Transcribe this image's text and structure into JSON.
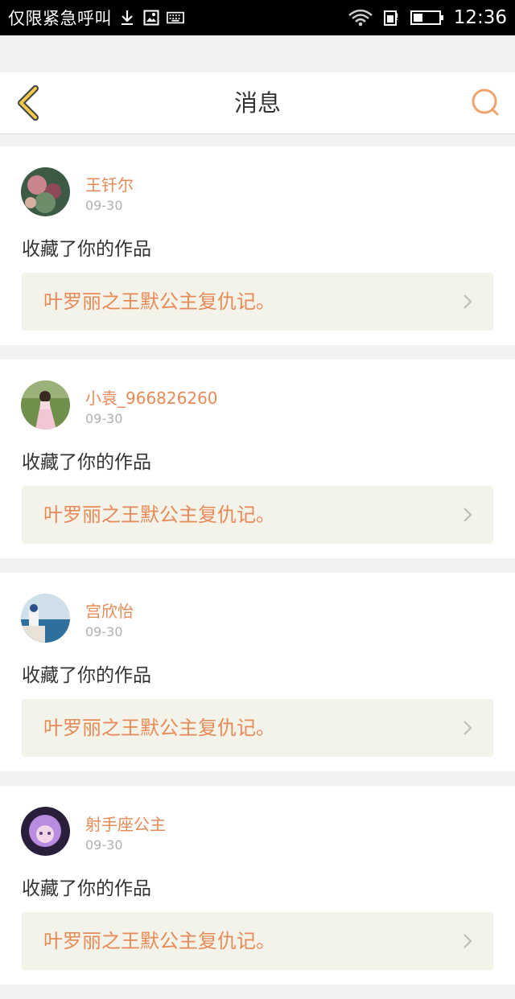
{
  "status_bar": {
    "carrier": "仅限紧急呼叫",
    "time": "12:36",
    "icons": [
      "download-icon",
      "image-icon",
      "keyboard-icon",
      "wifi-icon",
      "data-icon",
      "battery-icon"
    ]
  },
  "header": {
    "title": "消息",
    "back_icon": "chevron-left-icon",
    "search_icon": "search-icon",
    "accent_color": "#f2b44c",
    "search_color": "#f0a36c"
  },
  "messages": [
    {
      "username": "王钎尔",
      "date": "09-30",
      "action": "收藏了你的作品",
      "work_title": "叶罗丽之王默公主复仇记。"
    },
    {
      "username": "小袁_966826260",
      "date": "09-30",
      "action": "收藏了你的作品",
      "work_title": "叶罗丽之王默公主复仇记。"
    },
    {
      "username": "宫欣怡",
      "date": "09-30",
      "action": "收藏了你的作品",
      "work_title": "叶罗丽之王默公主复仇记。"
    },
    {
      "username": "射手座公主",
      "date": "09-30",
      "action": "收藏了你的作品",
      "work_title": "叶罗丽之王默公主复仇记。"
    }
  ],
  "colors": {
    "username": "#e88a57",
    "work_title": "#e88a57",
    "work_bg": "#f3f3ea"
  }
}
